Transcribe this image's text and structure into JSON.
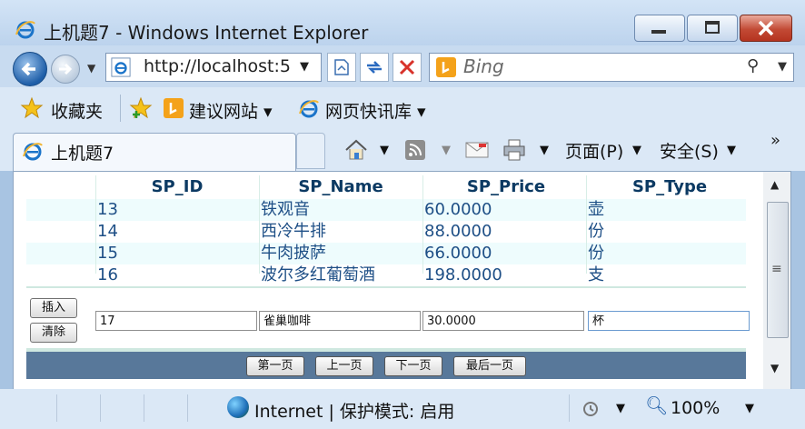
{
  "window": {
    "title": "上机题7 - Windows Internet Explorer"
  },
  "address_bar": {
    "url": "http://localhost:5",
    "search_placeholder": "Bing"
  },
  "favorites_bar": {
    "favorites_label": "收藏夹",
    "suggested_sites": "建议网站 ▾",
    "web_slice": "网页快讯库 ▾"
  },
  "tab": {
    "label": "上机题7"
  },
  "command_bar": {
    "page_menu": "页面(P)",
    "safety_menu": "安全(S)"
  },
  "grid": {
    "columns": [
      "SP_ID",
      "SP_Name",
      "SP_Price",
      "SP_Type"
    ],
    "rows": [
      [
        "13",
        "铁观音",
        "60.0000",
        "壶"
      ],
      [
        "14",
        "西冷牛排",
        "88.0000",
        "份"
      ],
      [
        "15",
        "牛肉披萨",
        "66.0000",
        "份"
      ],
      [
        "16",
        "波尔多红葡萄酒",
        "198.0000",
        "支"
      ]
    ],
    "insert_button": "插入",
    "clear_button": "清除",
    "edit_row": {
      "id": "17",
      "name": "雀巢咖啡",
      "price": "30.0000",
      "type": "杯"
    },
    "pager": {
      "first": "第一页",
      "prev": "上一页",
      "next": "下一页",
      "last": "最后一页"
    }
  },
  "status_bar": {
    "zone": "Internet | 保护模式: 启用",
    "zoom": "100%"
  }
}
